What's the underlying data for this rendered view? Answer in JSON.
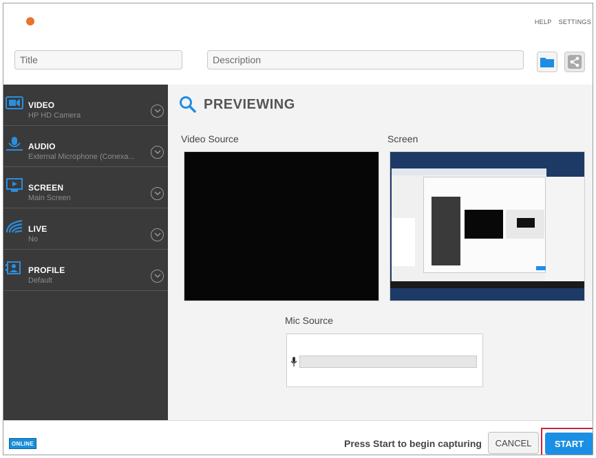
{
  "header": {
    "help_label": "HELP",
    "settings_label": "SETTINGS",
    "title_placeholder": "Title",
    "description_placeholder": "Description"
  },
  "sidebar": {
    "items": [
      {
        "title": "VIDEO",
        "subtitle": "HP HD Camera",
        "icon": "camera-icon"
      },
      {
        "title": "AUDIO",
        "subtitle": "External Microphone (Conexa...",
        "icon": "microphone-icon"
      },
      {
        "title": "SCREEN",
        "subtitle": "Main Screen",
        "icon": "screen-icon"
      },
      {
        "title": "LIVE",
        "subtitle": "No",
        "icon": "live-signal-icon"
      },
      {
        "title": "PROFILE",
        "subtitle": "Default",
        "icon": "profile-icon"
      }
    ]
  },
  "main": {
    "title": "PREVIEWING",
    "video_source_label": "Video Source",
    "screen_label": "Screen",
    "mic_source_label": "Mic Source"
  },
  "footer": {
    "status_badge": "ONLINE",
    "hint": "Press Start to begin capturing",
    "cancel_label": "CANCEL",
    "start_label": "START"
  },
  "colors": {
    "accent_blue": "#1b8fe3",
    "sidebar_bg": "#3a3a3a",
    "recording_dot": "#e8742e",
    "highlight_red": "#d4212b"
  }
}
